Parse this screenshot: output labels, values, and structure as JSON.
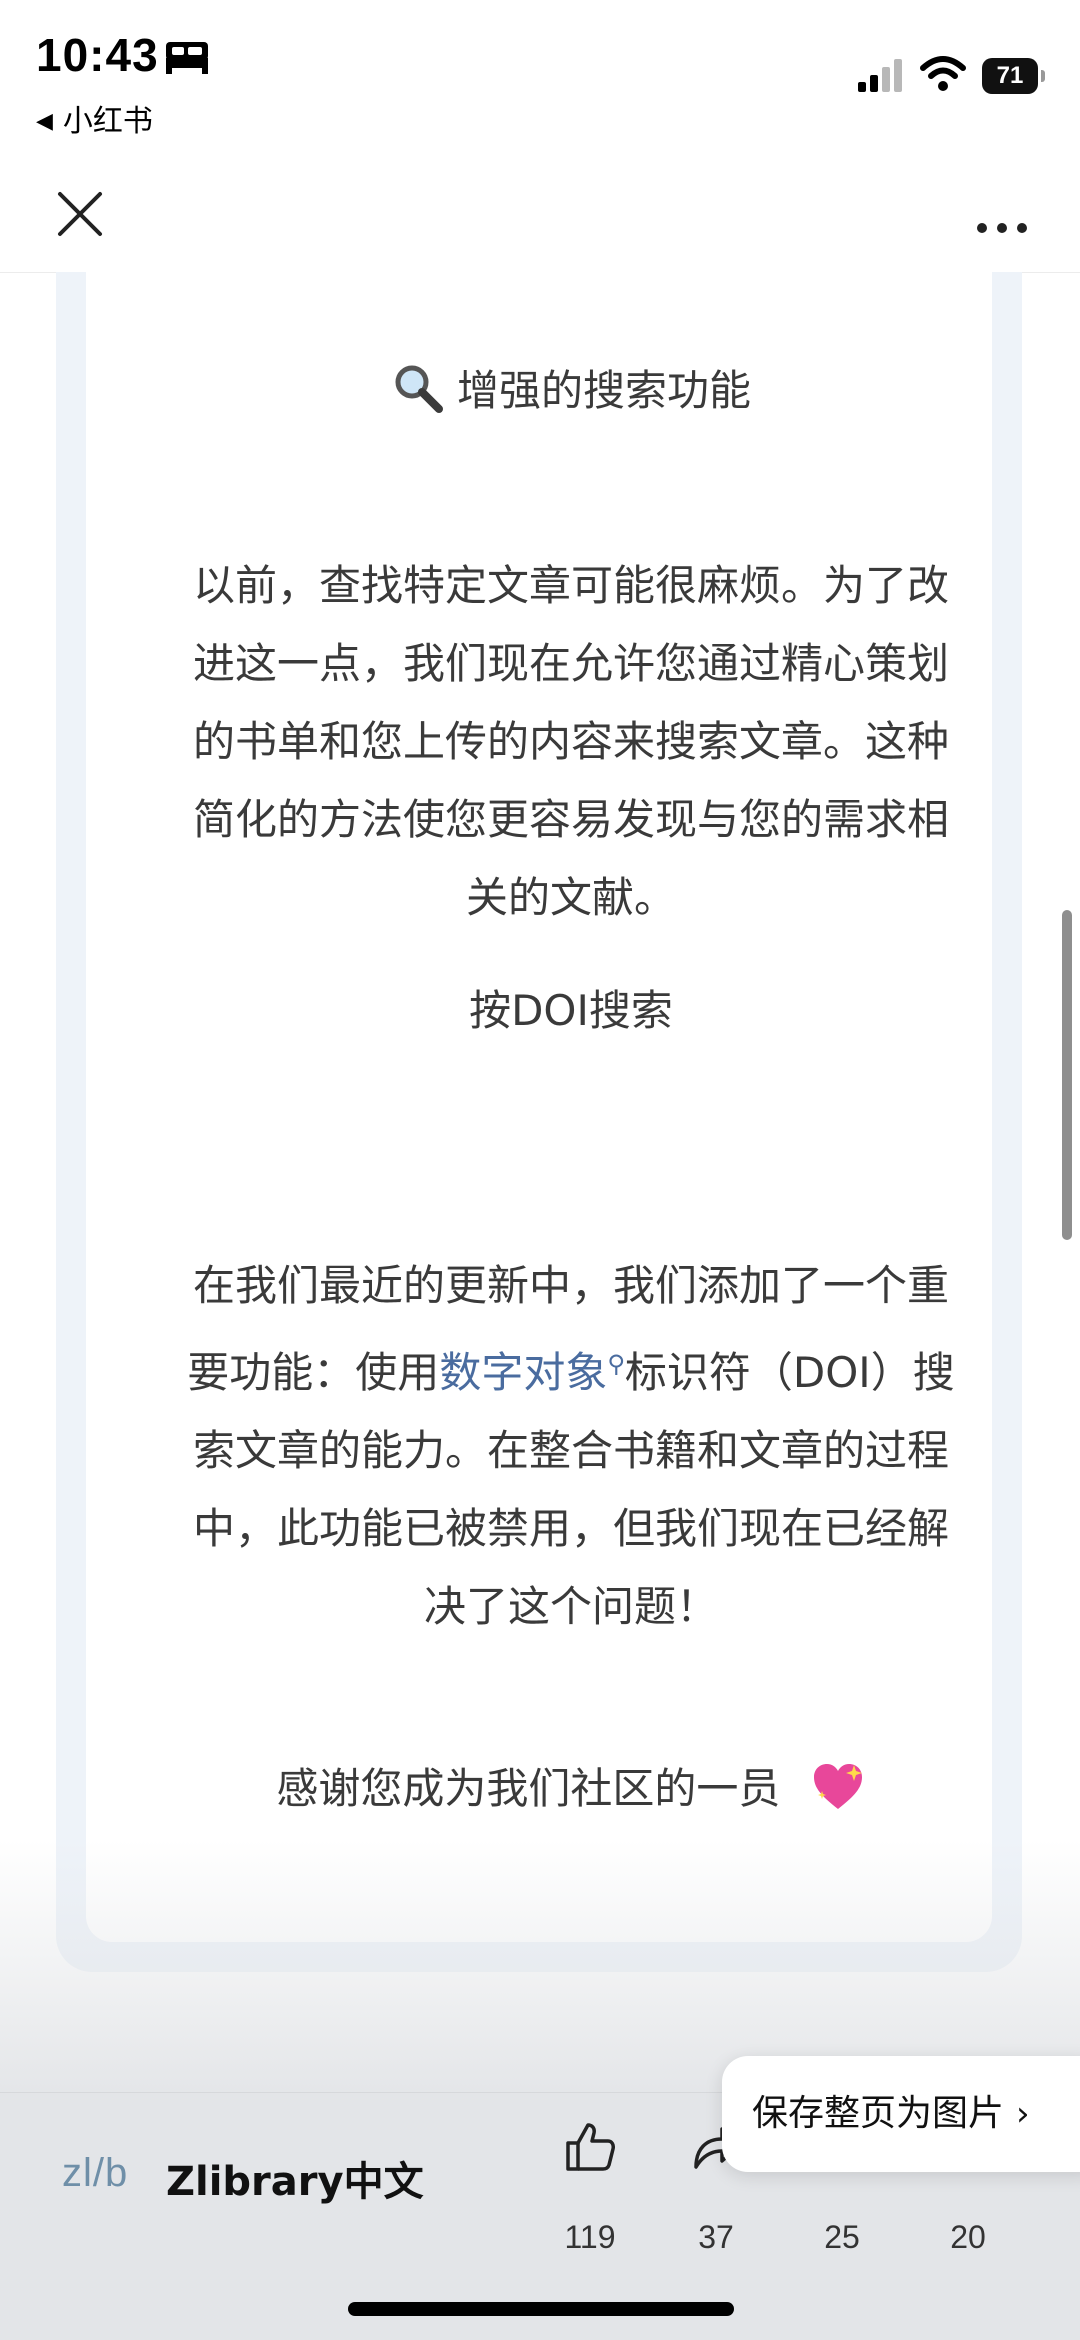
{
  "status_bar": {
    "time": "10:43",
    "back_app": "小红书",
    "battery": "71"
  },
  "content": {
    "heading1": "增强的搜索功能",
    "para1": "以前，查找特定文章可能很麻烦。为了改进这一点，我们现在允许您通过精心策划的书单和您上传的内容来搜索文章。这种简化的方法使您更容易发现与您的需求相关的文献。",
    "heading2": "按DOI搜索",
    "para2_before": "在我们最近的更新中，我们添加了一个重要功能：使用",
    "para2_link": "数字对象",
    "para2_after": "标识符（DOI）搜索文章的能力。在整合书籍和文章的过程中，此功能已被禁用，但我们现在已经解决了这个问题！",
    "para3": "感谢您成为我们社区的一员"
  },
  "bottom_bar": {
    "logo": "zl/b",
    "brand": "Zlibrary中文",
    "likes": "119",
    "shares": "37",
    "collects": "25",
    "comments": "20",
    "save_label": "保存整页为图片"
  },
  "icons": {
    "search_heading_icon": "magnifier-icon",
    "heart_icon": "sparkling-heart-icon"
  }
}
